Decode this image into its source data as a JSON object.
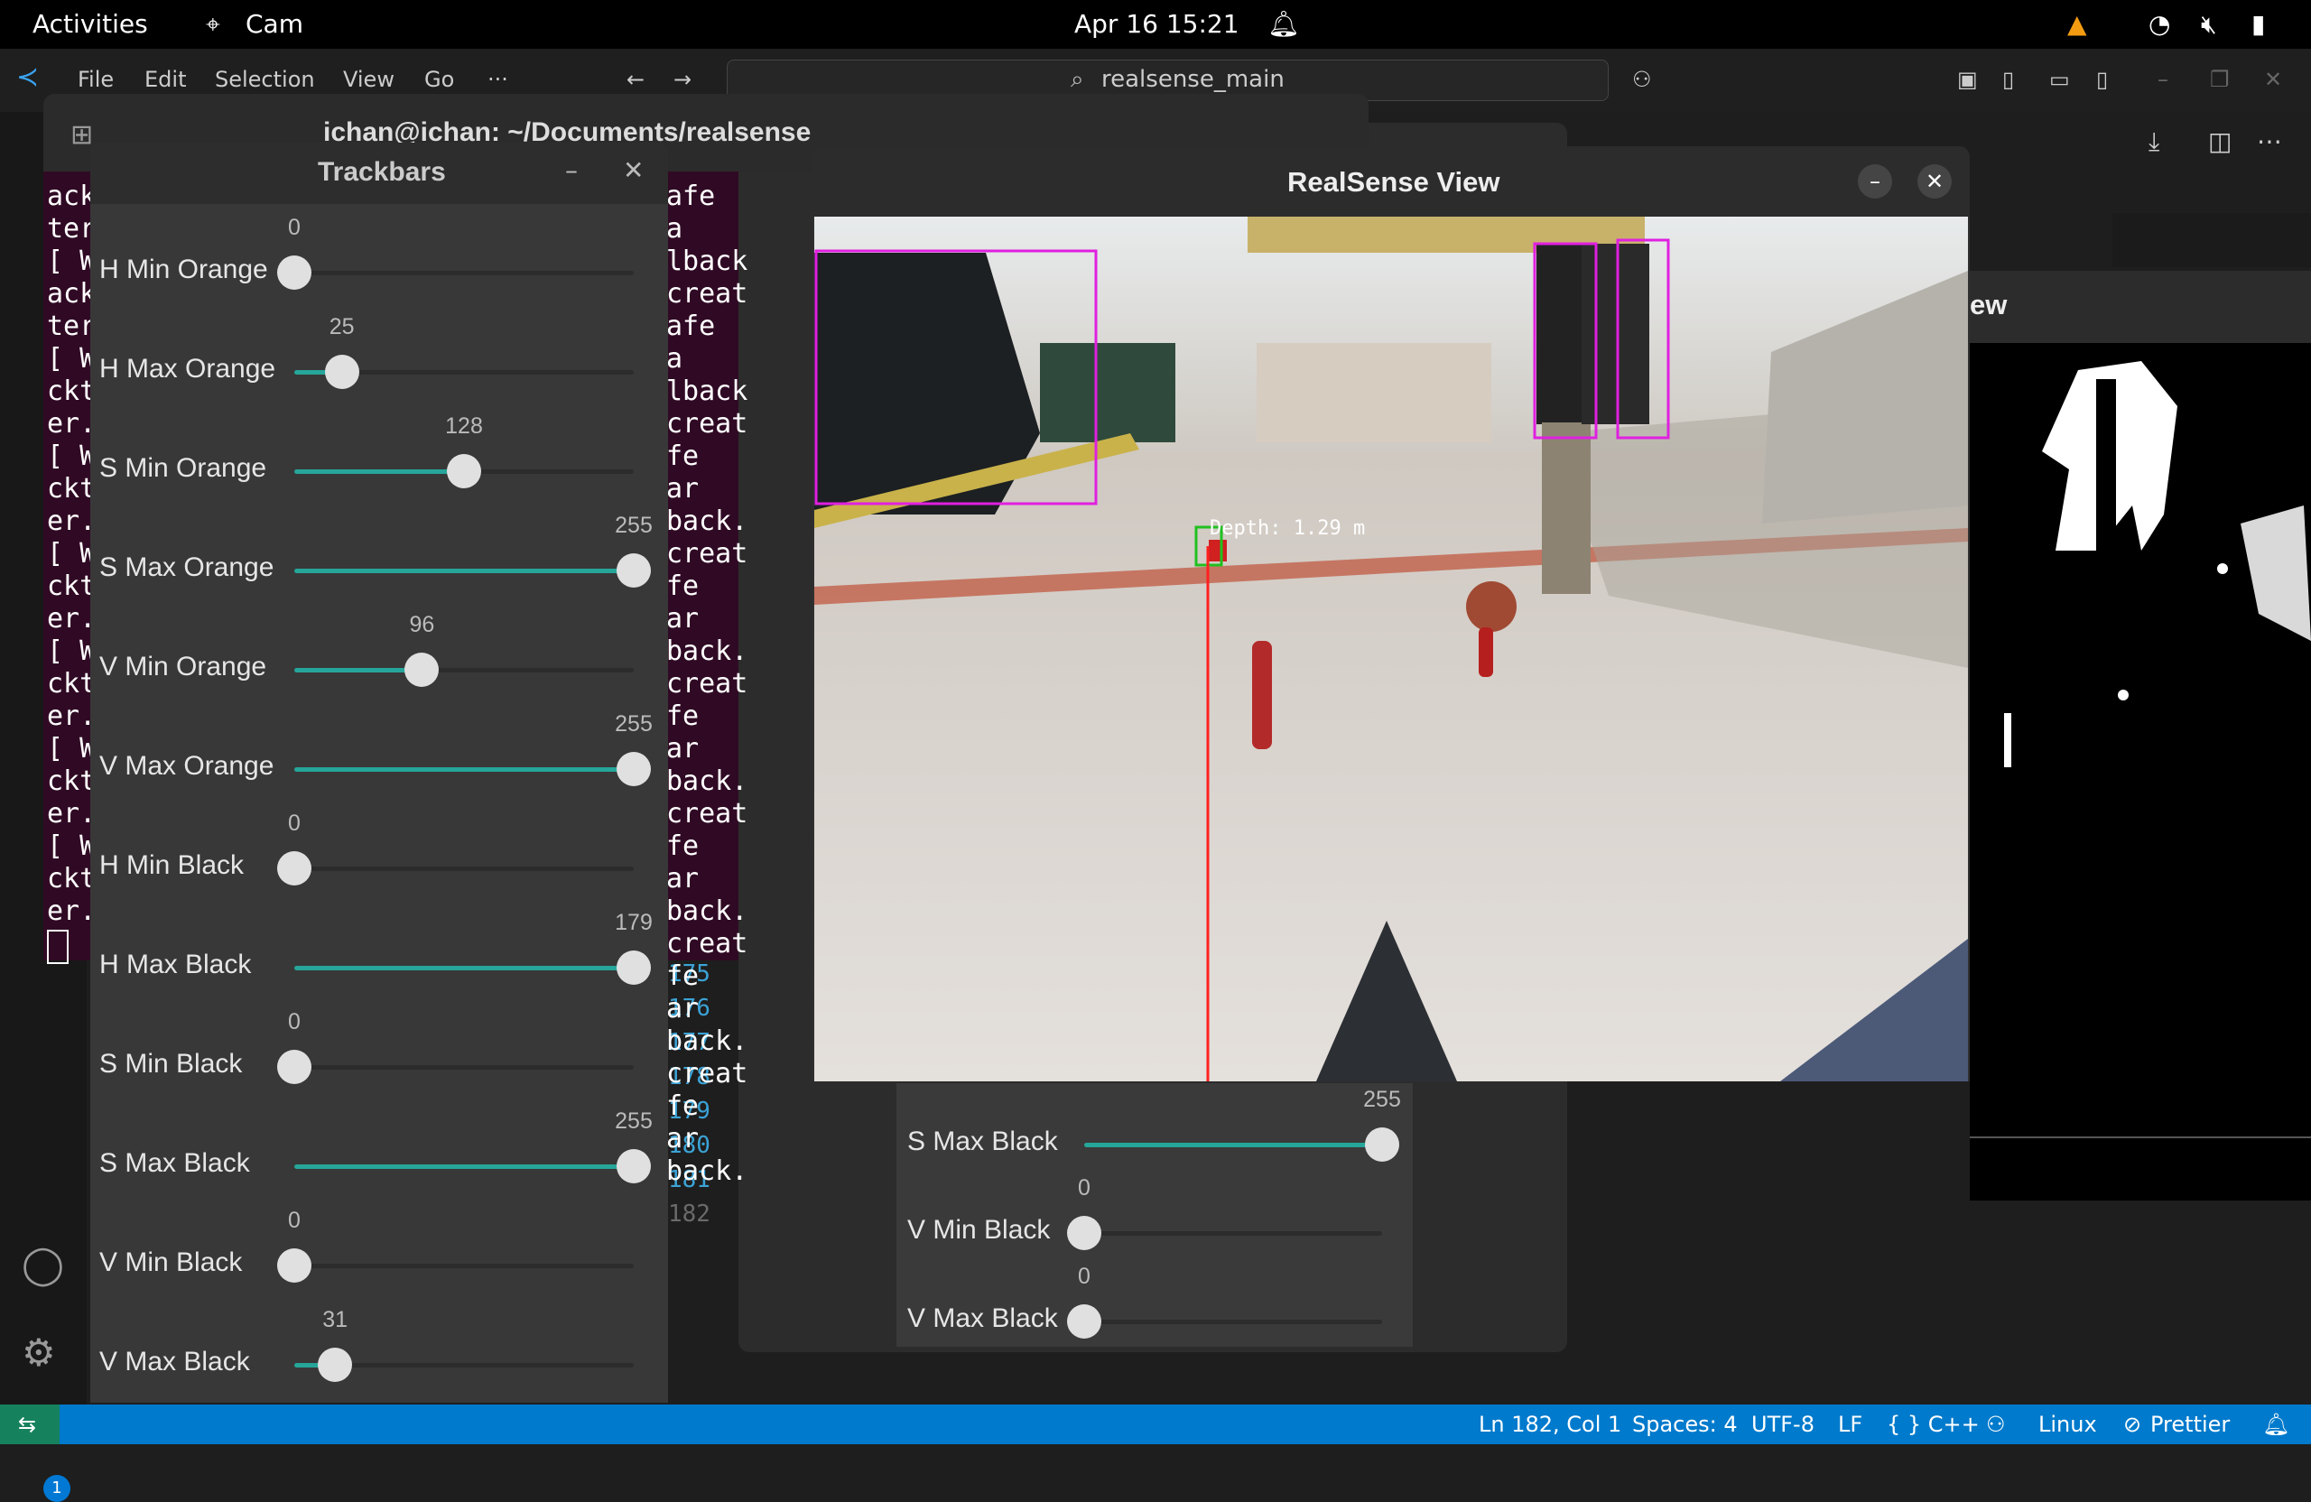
{
  "topbar": {
    "activities": "Activities",
    "app": "Cam",
    "datetime": "Apr 16  15:21"
  },
  "vscode": {
    "menu": [
      "File",
      "Edit",
      "Selection",
      "View",
      "Go",
      "···"
    ],
    "search": "realsense_main",
    "line_numbers": [
      "175",
      "176",
      "177",
      "178",
      "179",
      "180",
      "181",
      "182"
    ],
    "status": {
      "position": "Ln 182, Col 1",
      "spaces": "Spaces: 4",
      "encoding": "UTF-8",
      "eol": "LF",
      "language": "{ } C++",
      "platform": "Linux",
      "formatter": "Prettier",
      "badge": "1"
    }
  },
  "terminal": {
    "title": "ichan@ichan: ~/Documents/realsense",
    "left_lines": [
      "ack",
      "ter",
      "[ W",
      "ack",
      "ter",
      "[ W",
      "ckt",
      "er.",
      "[ W",
      "ckt",
      "er.",
      "[ W",
      "ckt",
      "er.",
      "[ W",
      "ckt",
      "er.",
      "[ W",
      "ckt",
      "er.",
      "[ W",
      "ckt",
      "er."
    ],
    "right_lines": [
      "afe a",
      "lback",
      "creat",
      "afe a",
      "lback",
      "creat",
      "fe ar",
      "back.",
      "creat",
      "fe ar",
      "back.",
      "creat",
      "fe ar",
      "back.",
      "creat",
      "fe ar",
      "back.",
      "creat",
      "fe ar",
      "back.",
      "creat",
      "fe ar",
      "back."
    ]
  },
  "trackbars": {
    "title": "Trackbars",
    "items": [
      {
        "label": "H Min Orange",
        "value": "0",
        "fraction": 0.0
      },
      {
        "label": "H Max Orange",
        "value": "25",
        "fraction": 0.14
      },
      {
        "label": "S Min Orange",
        "value": "128",
        "fraction": 0.5
      },
      {
        "label": "S Max Orange",
        "value": "255",
        "fraction": 1.0
      },
      {
        "label": "V Min Orange",
        "value": "96",
        "fraction": 0.376
      },
      {
        "label": "V Max Orange",
        "value": "255",
        "fraction": 1.0
      },
      {
        "label": "H Min Black",
        "value": "0",
        "fraction": 0.0
      },
      {
        "label": "H Max Black",
        "value": "179",
        "fraction": 1.0
      },
      {
        "label": "S Min Black",
        "value": "0",
        "fraction": 0.0
      },
      {
        "label": "S Max Black",
        "value": "255",
        "fraction": 1.0
      },
      {
        "label": "V Min Black",
        "value": "0",
        "fraction": 0.0
      },
      {
        "label": "V Max Black",
        "value": "31",
        "fraction": 0.12
      }
    ]
  },
  "lower_trackbars": [
    {
      "label": "S Max Black",
      "value": "255",
      "fraction": 1.0
    },
    {
      "label": "V Min Black",
      "value": "0",
      "fraction": 0.0
    },
    {
      "label": "V Max Black",
      "value": "0",
      "fraction": 0.0
    }
  ],
  "realsense": {
    "title": "RealSense View",
    "depth_label": "Depth: 1.29 m"
  },
  "mask_window": {
    "title_fragment": "ew"
  }
}
